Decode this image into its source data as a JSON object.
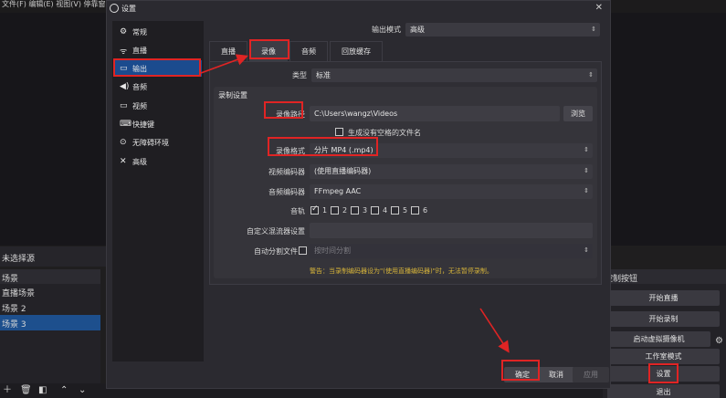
{
  "app": {
    "menubar": "文件(F)  编辑(E)  视图(V)  停靠窗...",
    "no_source": "未选择源",
    "scenes_header": "场景",
    "scenes": [
      "直播场景",
      "场景 2",
      "场景 3"
    ],
    "controls_header": "控制按钮",
    "controls": [
      "开始直播",
      "开始录制",
      "启动虚拟摄像机",
      "工作室模式",
      "设置",
      "退出"
    ]
  },
  "dialog": {
    "title": "设置",
    "close_glyph": "✕",
    "sidebar": [
      {
        "label": "常规",
        "icon": "gear-icon",
        "glyph": "⚙"
      },
      {
        "label": "直播",
        "icon": "antenna-icon",
        "glyph": "📶"
      },
      {
        "label": "输出",
        "icon": "output-icon",
        "glyph": "▭"
      },
      {
        "label": "音频",
        "icon": "speaker-icon",
        "glyph": "◀)"
      },
      {
        "label": "视频",
        "icon": "monitor-icon",
        "glyph": "▭"
      },
      {
        "label": "快捷键",
        "icon": "keyboard-icon",
        "glyph": "⌨"
      },
      {
        "label": "无障碍环境",
        "icon": "accessibility-icon",
        "glyph": "⊙"
      },
      {
        "label": "高级",
        "icon": "tools-icon",
        "glyph": "✕"
      }
    ],
    "output_mode_label": "输出模式",
    "output_mode_value": "高级",
    "tabs": [
      "直播",
      "录像",
      "音频",
      "回放缓存"
    ],
    "type_label": "类型",
    "type_value": "标准",
    "group_title": "录制设置",
    "path_label": "录像路径",
    "path_value": "C:\\Users\\wangz\\Videos",
    "browse_label": "浏览",
    "no_space_label": "生成没有空格的文件名",
    "format_label": "录像格式",
    "format_value": "分片 MP4 (.mp4)",
    "video_encoder_label": "视频编码器",
    "video_encoder_value": "(使用直播编码器)",
    "audio_encoder_label": "音频编码器",
    "audio_encoder_value": "FFmpeg AAC",
    "tracks_label": "音轨",
    "tracks": [
      "1",
      "2",
      "3",
      "4",
      "5",
      "6"
    ],
    "muxer_label": "自定义混流器设置",
    "autosplit_label": "自动分割文件",
    "autosplit_value": "按时间分割",
    "warning": "警告：当录制编码器设为\"(使用直播编码器)\"时，无法暂停录制。",
    "ok_label": "确定",
    "cancel_label": "取消",
    "apply_label": "应用"
  },
  "colors": {
    "accent": "#1b4b8e",
    "annotation_red": "#e02424",
    "warning": "#d6b43a"
  }
}
